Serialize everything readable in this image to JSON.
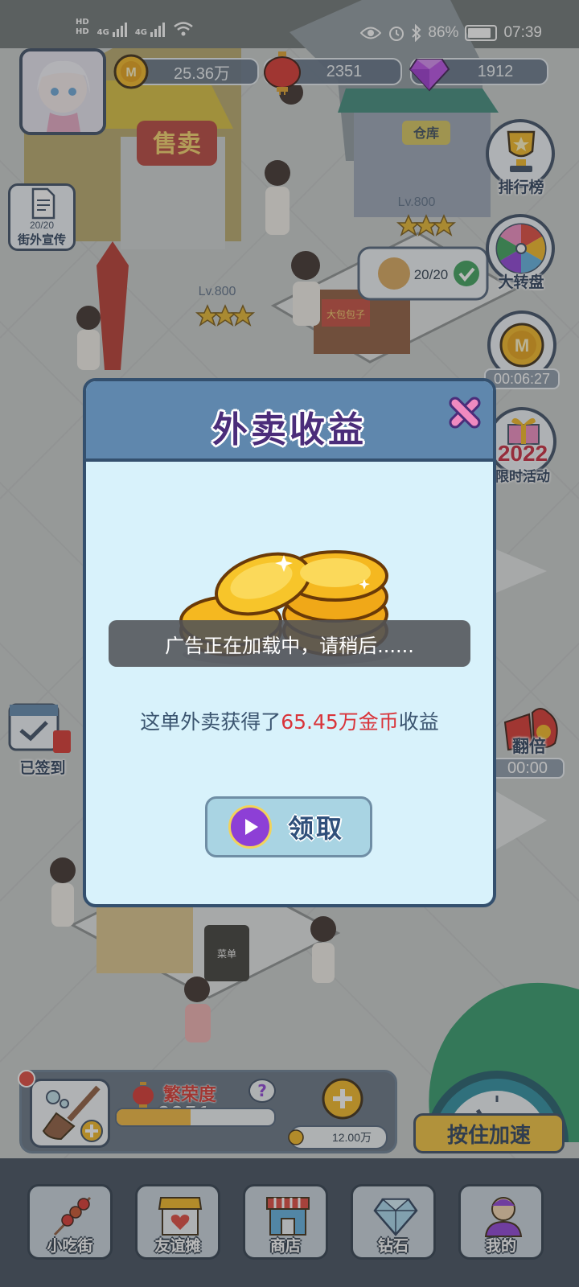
{
  "status_bar": {
    "network_1": "4G",
    "network_2": "4G",
    "battery": "86%",
    "battery_level": 0.86,
    "time": "07:39"
  },
  "currencies": {
    "coins": "25.36万",
    "lanterns": "2351",
    "diamonds": "1912"
  },
  "side_left": {
    "street_promo_count": "20/20",
    "street_promo_label": "街外宣传",
    "checked_in_label": "已签到"
  },
  "side_right": {
    "leaderboard_label": "排行榜",
    "wheel_label": "大转盘",
    "coin_timer": "00:06:27",
    "event_year": "2022",
    "event_label": "限时活动",
    "double_label": "翻倍",
    "double_timer": "00:00"
  },
  "world": {
    "shop_sign": "售卖",
    "warehouse_sign": "仓库",
    "level_a": "Lv.800",
    "level_b": "Lv.800",
    "stock_count": "20/20",
    "stall_sign": "大包包子",
    "menu_board": "菜单"
  },
  "modal": {
    "title": "外卖收益",
    "message_prefix": "这单外卖获得了",
    "message_highlight": "65.45万金币",
    "message_suffix": "收益",
    "claim_label": "领取"
  },
  "toast": "广告正在加载中，请稍后......",
  "prosperity": {
    "label": "繁荣度",
    "value": "2351",
    "progress": 0.47,
    "coin_cost": "12.00万"
  },
  "speed_up_label": "按住加速",
  "bottom_nav": [
    {
      "label": "小吃街",
      "icon": "skewer-icon"
    },
    {
      "label": "友谊摊",
      "icon": "heart-stall-icon"
    },
    {
      "label": "商店",
      "icon": "shop-icon"
    },
    {
      "label": "钻石",
      "icon": "diamond-icon"
    },
    {
      "label": "我的",
      "icon": "profile-icon"
    }
  ],
  "colors": {
    "modal_header": "#5f87ad",
    "modal_body": "#d8f2fb",
    "highlight_red": "#d9343a",
    "title_purple": "#4b2d7a",
    "coin_gold": "#f5b820"
  }
}
